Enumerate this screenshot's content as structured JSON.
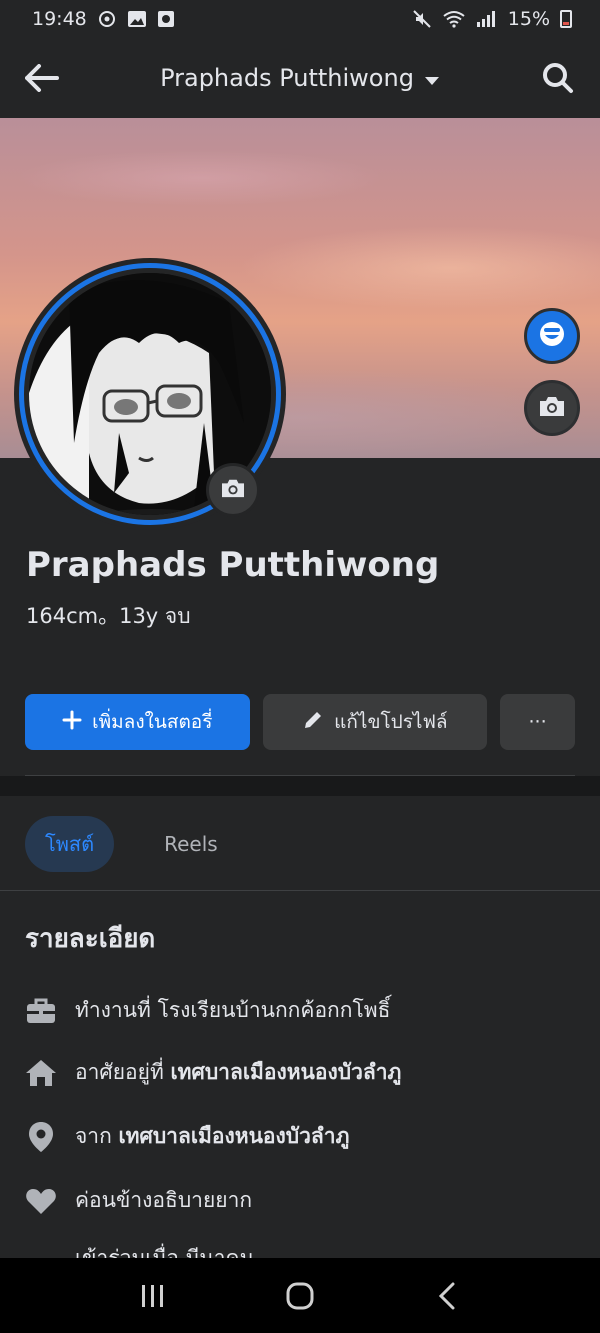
{
  "status_bar": {
    "time": "19:48",
    "battery": "15%"
  },
  "header": {
    "title": "Praphads Putthiwong"
  },
  "profile": {
    "name": "Praphads Putthiwong",
    "bio": "164cm。13y จบ"
  },
  "actions": {
    "add_story": "เพิ่มลงในสตอรี่",
    "edit_profile": "แก้ไขโปรไฟล์",
    "more": "···"
  },
  "tabs": [
    {
      "label": "โพสต์",
      "active": true
    },
    {
      "label": "Reels",
      "active": false
    }
  ],
  "details": {
    "title": "รายละเอียด",
    "work_prefix": "ทำงานที่ ",
    "work": "โรงเรียนบ้านกกค้อกกโพธิ์",
    "lives_prefix": "อาศัยอยู่ที่ ",
    "lives": "เทศบาลเมืองหนองบัวลำภู",
    "from_prefix": "จาก ",
    "from": "เทศบาลเมืองหนองบัวลำภู",
    "relationship": "ค่อนข้างอธิบายยาก",
    "clipped": "เข้าร่วมเมื่อ มีนาคม"
  },
  "icons": {
    "back": "arrow-left-icon",
    "dropdown": "caret-down-icon",
    "search": "search-icon"
  },
  "colors": {
    "accent": "#1b74e4",
    "background": "#242526"
  }
}
